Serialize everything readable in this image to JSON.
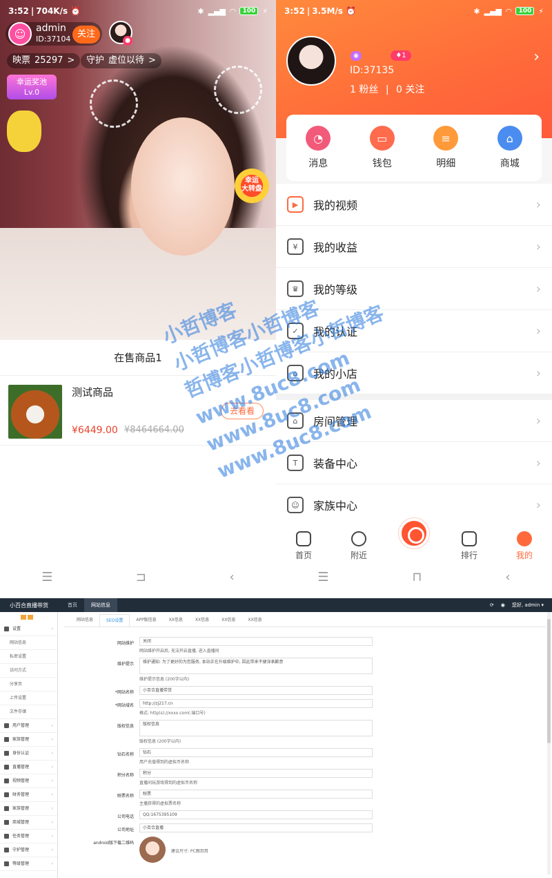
{
  "left": {
    "status": {
      "time": "3:52",
      "speed": "704K/s",
      "battery": "100"
    },
    "anchor": {
      "name": "admin",
      "id": "ID:37104",
      "follow": "关注"
    },
    "votes": {
      "label": "映票",
      "value": "25297",
      "arrow": ">"
    },
    "guard": {
      "label": "守护",
      "value": "虚位以待",
      "arrow": ">"
    },
    "lucky": {
      "line1": "幸运奖池",
      "line2": "Lv.0"
    },
    "wheel": {
      "line1": "幸运",
      "line2": "大转盘"
    },
    "goods_header": "在售商品1",
    "goods": {
      "name": "测试商品",
      "price": "¥6449.00",
      "old_price": "¥8464664.00",
      "button": "去看看"
    },
    "nav": [
      "☰",
      "⊐",
      "‹"
    ]
  },
  "right": {
    "status": {
      "time": "3:52",
      "speed": "3.5M/s",
      "battery": "100"
    },
    "profile": {
      "id": "ID:37135",
      "fans": "1 粉丝",
      "following": "0 关注",
      "vip_level": "1",
      "arrow": "›"
    },
    "quick": [
      {
        "label": "消息",
        "color": "#f25a7a"
      },
      {
        "label": "钱包",
        "color": "#ff6b4d"
      },
      {
        "label": "明细",
        "color": "#ff9a3a"
      },
      {
        "label": "商城",
        "color": "#4a8cf0"
      }
    ],
    "menu_group1": [
      {
        "label": "我的视频",
        "icon": "video-icon"
      },
      {
        "label": "我的收益",
        "icon": "money-bag-icon"
      },
      {
        "label": "我的等级",
        "icon": "crown-icon"
      },
      {
        "label": "我的认证",
        "icon": "verified-icon"
      },
      {
        "label": "我的小店",
        "icon": "shop-icon"
      }
    ],
    "menu_group2": [
      {
        "label": "房间管理",
        "icon": "home-icon"
      },
      {
        "label": "装备中心",
        "icon": "shirt-icon"
      },
      {
        "label": "家族中心",
        "icon": "family-icon"
      }
    ],
    "tabs": [
      {
        "label": "首页"
      },
      {
        "label": "附近"
      },
      {
        "label": "排行"
      },
      {
        "label": "我的"
      }
    ],
    "nav": [
      "☰",
      "⊓",
      "‹"
    ]
  },
  "watermark": [
    "小哲博客",
    "小哲博客小哲博客",
    "哲博客小哲博客小哲博客",
    "www.8uc8.com",
    "www.8uc8.com",
    "www.8uc8.com"
  ],
  "admin": {
    "brand": "小百合直播带货",
    "top_tabs": [
      "首页",
      "网站信息"
    ],
    "user": "您好, admin ▾",
    "side": [
      {
        "label": "设置",
        "sub": false
      },
      {
        "label": "网站信息",
        "sub": true
      },
      {
        "label": "私密设置",
        "sub": true
      },
      {
        "label": "访问方式",
        "sub": true
      },
      {
        "label": "分享页",
        "sub": true
      },
      {
        "label": "上传设置",
        "sub": true
      },
      {
        "label": "文件存储",
        "sub": true
      },
      {
        "label": "用户管理",
        "sub": false
      },
      {
        "label": "家族管理",
        "sub": false
      },
      {
        "label": "身份认证",
        "sub": false
      },
      {
        "label": "直播管理",
        "sub": false
      },
      {
        "label": "视频管理",
        "sub": false
      },
      {
        "label": "财务管理",
        "sub": false
      },
      {
        "label": "家族管理",
        "sub": false
      },
      {
        "label": "商城管理",
        "sub": false
      },
      {
        "label": "任务管理",
        "sub": false
      },
      {
        "label": "守护管理",
        "sub": false
      },
      {
        "label": "等级管理",
        "sub": false
      }
    ],
    "sub_tabs": [
      "网站信息",
      "SEO设置",
      "APP版信息",
      "XX信息",
      "XX信息",
      "XX信息",
      "XX信息"
    ],
    "fields": [
      {
        "label": "网站维护",
        "value": "关闭",
        "help": "网站维护开启后, 无法开启直播, 进入直播间"
      },
      {
        "label": "维护提示",
        "value": "维护通知: 为了更好的为您服务, 本站正在升级维护中, 因此带来不便深表歉意",
        "help": "维护提示信息 (200字以内)"
      },
      {
        "label": "*网站名称",
        "value": "小百合直播带货",
        "help": ""
      },
      {
        "label": "*网站域名",
        "value": "http://zj217.cn",
        "help": "格式: http(s)://xxxx.com(:端口号)"
      },
      {
        "label": "版权信息",
        "value": "版权信息",
        "help": "版权信息 (200字以内)"
      },
      {
        "label": "钻石名称",
        "value": "钻石",
        "help": "用户充值得到的虚拟币名称"
      },
      {
        "label": "积分名称",
        "value": "积分",
        "help": "直播间玩游戏得到的虚拟币名称"
      },
      {
        "label": "映票名称",
        "value": "映票",
        "help": "主播获得的虚拟票名称"
      },
      {
        "label": "公司电话",
        "value": "QQ:1675395109",
        "help": ""
      },
      {
        "label": "公司地址",
        "value": "小百合直播",
        "help": ""
      }
    ],
    "qr": {
      "label": "android版下载二维码",
      "note": "建议尺寸: PC图页用"
    }
  }
}
